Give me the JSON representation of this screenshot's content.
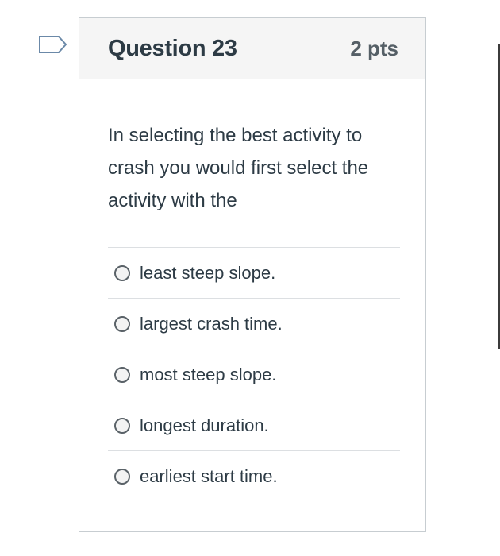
{
  "question": {
    "title": "Question 23",
    "points": "2 pts",
    "text": "In selecting the best activity to crash you would first select the activity with the",
    "flag_icon": "bookmark-flag-icon"
  },
  "answers": [
    {
      "label": "least steep slope."
    },
    {
      "label": "largest crash time."
    },
    {
      "label": "most steep slope."
    },
    {
      "label": "longest duration."
    },
    {
      "label": "earliest start time."
    }
  ],
  "colors": {
    "header_bg": "#f5f5f5",
    "border": "#c7cdd1",
    "text": "#2d3b45"
  }
}
